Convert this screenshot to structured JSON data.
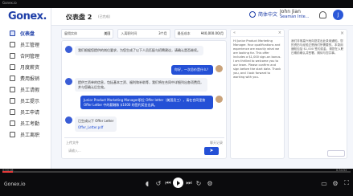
{
  "player": {
    "title": "Gonex.io",
    "progress_fraction": 0.03,
    "time_left": "0:04:18",
    "time_right": "0:34:52"
  },
  "app": {
    "logo": "Gonex.",
    "page_title": "仪表盘 2",
    "page_sub": "(已完成)",
    "language": "简体中文",
    "user_name": "John Jian",
    "user_org": "Seaman Inte...",
    "avatar_letter": "J"
  },
  "sidebar": {
    "items": [
      {
        "label": "仪表盘",
        "active": true
      },
      {
        "label": "员工管理",
        "active": false
      },
      {
        "label": "合同管理",
        "active": false
      },
      {
        "label": "月度薪资",
        "active": false
      },
      {
        "label": "费用报销",
        "active": false
      },
      {
        "label": "员工请假",
        "active": false
      },
      {
        "label": "员工提示",
        "active": false
      },
      {
        "label": "员工申请",
        "active": false
      },
      {
        "label": "员工考勤",
        "active": false
      },
      {
        "label": "员工离职",
        "active": false
      }
    ]
  },
  "filters": [
    {
      "label": "雇佣实体",
      "value": "美国"
    },
    {
      "label": "入离职时间",
      "value": "3个月"
    },
    {
      "label": "最低成本",
      "value": "¥40,000.00/月"
    }
  ],
  "chat": {
    "messages": [
      {
        "from": "bot",
        "text": "我们根据您提供的岗位要求，为您生成了以下人员匹配与招聘建议，请确认是否继续。"
      },
      {
        "from": "me",
        "text": "你好，一次总价是什么？"
      },
      {
        "from": "bot",
        "text": "提供工资单的信息，包括基本工资、福利和补助等，我们将在合同中详细列出各项费用，并与您确认后生效。"
      },
      {
        "from": "me",
        "text": "Junior Product Marketing Manager职位 Offer letter（美国员工），请在合同里按 Offer Letter 中的薪酬和 $1000 的签约奖金出具。"
      },
      {
        "from": "bot",
        "text": "已生成以下 Offer Letter",
        "attachment": "Offer_Letter.pdf"
      }
    ],
    "tools_left": "上传文件",
    "tools_right": "聊天记录",
    "input_placeholder": "请输入...",
    "send_label": "➤"
  },
  "doc_mid": {
    "text": "Hi Junior Product Marketing Manager. Your qualifications and experience are exactly what we are looking for. This offer includes a $1,000 sign-on bonus. I am thrilled to welcome you to our team. Please confirm and sign before the start date. Thank you, and I look forward to working with you."
  },
  "doc_right": {
    "text": "我们非常高兴地向您发出此录用通知。您的资历与经验正是我们所需要的。本录用通知包括 $1,000 签约奖金。请您在入职日期前确认并签署。期待与您共事。"
  }
}
